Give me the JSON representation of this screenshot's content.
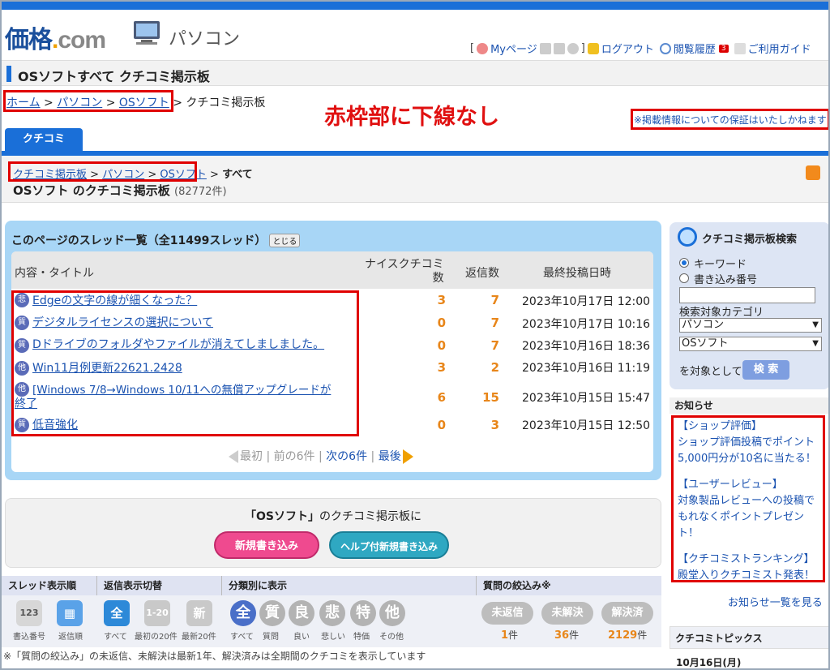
{
  "header": {
    "logo_main": "価格",
    "logo_dot": ".",
    "logo_com": "com",
    "category": "パソコン",
    "mypage": "Myページ",
    "logout": "ログアウト",
    "history": "閲覧履歴",
    "history_count": "3",
    "guide": "ご利用ガイド",
    "bracket_open": "[",
    "bracket_close": "]"
  },
  "page_title": "OSソフトすべて クチコミ掲示板",
  "breadcrumb": {
    "home": "ホーム",
    "pc": "パソコン",
    "os": "OSソフト",
    "current": "クチコミ掲示板",
    "sep": ">"
  },
  "annotation_note": "赤枠部に下線なし",
  "disclaimer": "※掲載情報についての保証はいたしかねます",
  "tab_label": "クチコミ",
  "breadcrumb2": {
    "board": "クチコミ掲示板",
    "pc": "パソコン",
    "os": "OSソフト",
    "current": "すべて",
    "sep": ">"
  },
  "board_title": "OSソフト のクチコミ掲示板",
  "board_count": "(82772件)",
  "thread_list": {
    "title": "このページのスレッド一覧（全11499スレッド）",
    "close_label": "とじる",
    "columns": {
      "title": "内容・タイトル",
      "nice": "ナイスクチコミ数",
      "nice_1": "ナイスクチコミ",
      "nice_2": "数",
      "reply": "返信数",
      "date": "最終投稿日時"
    },
    "rows": [
      {
        "icon": "悲",
        "title": "Edgeの文字の線が細くなった？",
        "nice": "3",
        "reply": "7",
        "date": "2023年10月17日 12:00"
      },
      {
        "icon": "質",
        "title": "デジタルライセンスの選択について",
        "nice": "0",
        "reply": "7",
        "date": "2023年10月17日 10:16"
      },
      {
        "icon": "質",
        "title": "Dドライブのフォルダやファイルが消えてしましました。",
        "nice": "0",
        "reply": "7",
        "date": "2023年10月16日 18:36"
      },
      {
        "icon": "他",
        "title": "Win11月例更新22621.2428",
        "nice": "3",
        "reply": "2",
        "date": "2023年10月16日 11:19"
      },
      {
        "icon": "他",
        "title": "[Windows 7/8→Windows 10/11への無償アップグレードが",
        "title2": "終了",
        "nice": "6",
        "reply": "15",
        "date": "2023年10月15日 15:47"
      },
      {
        "icon": "質",
        "title": "低音強化",
        "nice": "0",
        "reply": "3",
        "date": "2023年10月15日 12:50"
      }
    ],
    "pager": {
      "first": "最初",
      "prev": "前の6件",
      "next": "次の6件",
      "last": "最後",
      "sep": "|"
    }
  },
  "post": {
    "board_name": "「OSソフト」",
    "label_suffix": "のクチコミ掲示板に",
    "new_button": "新規書き込み",
    "help_button": "ヘルプ付新規書き込み"
  },
  "filters": {
    "order_header": "スレッド表示順",
    "reply_header": "返信表示切替",
    "category_header": "分類別に表示",
    "question_header": "質問の絞込み※",
    "order": [
      {
        "icon": "123",
        "label": "書込番号"
      },
      {
        "icon": "▦",
        "label": "返信順"
      }
    ],
    "reply": [
      {
        "icon": "全",
        "label": "すべて"
      },
      {
        "icon": "1-20",
        "label": "最初の20件"
      },
      {
        "icon": "新",
        "label": "最新20件"
      }
    ],
    "categories": [
      {
        "icon": "全",
        "label": "すべて"
      },
      {
        "icon": "質",
        "label": "質問"
      },
      {
        "icon": "良",
        "label": "良い"
      },
      {
        "icon": "悲",
        "label": "悲しい"
      },
      {
        "icon": "特",
        "label": "特価"
      },
      {
        "icon": "他",
        "label": "その他"
      }
    ],
    "question": [
      {
        "label": "未返信",
        "count": "1",
        "unit": "件"
      },
      {
        "label": "未解決",
        "count": "36",
        "unit": "件"
      },
      {
        "label": "解決済",
        "count": "2129",
        "unit": "件"
      }
    ]
  },
  "footnote": "※「質問の絞込み」の未返信、未解決は最新1年、解決済みは全期間のクチコミを表示しています",
  "search": {
    "title": "クチコミ掲示板検索",
    "radio_keyword": "キーワード",
    "radio_number": "書き込み番号",
    "input_value": "",
    "category_label": "検索対象カテゴリ",
    "select1": "パソコン",
    "select2": "OSソフト",
    "target_label": "を対象として",
    "button": "検 索"
  },
  "news": {
    "header": "お知らせ",
    "items": [
      {
        "title": "【ショップ評価】",
        "body": "ショップ評価投稿でポイント5,000円分が10名に当たる！"
      },
      {
        "title": "【ユーザーレビュー】",
        "body": "対象製品レビューへの投稿でもれなくポイントプレゼント！"
      },
      {
        "title": "【クチコミストランキング】",
        "body": "殿堂入りクチコミスト発表！"
      }
    ],
    "more": "お知らせ一覧を見る"
  },
  "topics": {
    "header": "クチコミトピックス",
    "date": "10月16日(月)"
  },
  "colors": {
    "accent": "#1a6fd8",
    "highlight_border": "#e00000",
    "count_orange": "#e8861a",
    "link": "#1a52b0"
  }
}
